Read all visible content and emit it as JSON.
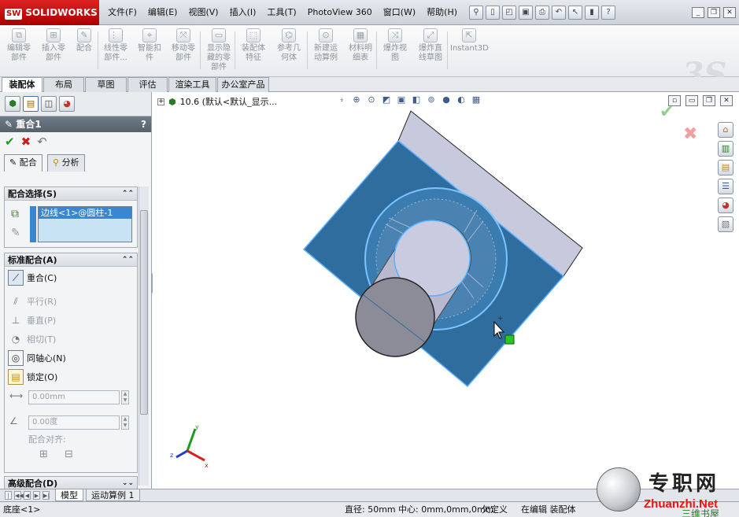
{
  "app": {
    "name": "SOLIDWORKS",
    "badge": "SW"
  },
  "menu": [
    "文件(F)",
    "编辑(E)",
    "视图(V)",
    "插入(I)",
    "工具(T)",
    "PhotoView 360",
    "窗口(W)",
    "帮助(H)"
  ],
  "quickbar_icons": [
    "pin-icon",
    "new-icon",
    "open-icon",
    "save-icon",
    "print-icon",
    "undo-icon",
    "select-icon",
    "rebuild-icon",
    "options-icon"
  ],
  "commands": [
    {
      "label": "编辑零\n部件",
      "icon": "edit-component-icon"
    },
    {
      "label": "插入零\n部件",
      "icon": "insert-component-icon"
    },
    {
      "label": "配合",
      "icon": "mate-icon"
    },
    {
      "label": "线性零\n部件...",
      "icon": "linear-pattern-icon"
    },
    {
      "label": "智能扣\n件",
      "icon": "smart-fastener-icon"
    },
    {
      "label": "移动零\n部件",
      "icon": "move-component-icon"
    },
    {
      "label": "显示隐\n藏的零\n部件",
      "icon": "show-hidden-icon"
    },
    {
      "label": "装配体\n特征",
      "icon": "assembly-feature-icon"
    },
    {
      "label": "参考几\n何体",
      "icon": "reference-geometry-icon"
    },
    {
      "label": "新建运\n动算例",
      "icon": "motion-study-icon"
    },
    {
      "label": "材料明\n细表",
      "icon": "bom-icon"
    },
    {
      "label": "爆炸视\n图",
      "icon": "exploded-view-icon"
    },
    {
      "label": "爆炸直\n线草图",
      "icon": "explode-line-icon"
    },
    {
      "label": "Instant3D",
      "icon": "instant3d-icon"
    }
  ],
  "tabs": [
    "装配体",
    "布局",
    "草图",
    "评估",
    "渲染工具",
    "办公室产品"
  ],
  "panel": {
    "title": "重合1",
    "help": "?",
    "subtabs": [
      "配合",
      "分析"
    ],
    "mate_selections": {
      "title": "配合选择(S)",
      "items": [
        "边线<1>@圆柱-1"
      ]
    },
    "standard_mates": {
      "title": "标准配合(A)",
      "options": [
        {
          "label": "重合(C)",
          "icon": "coincident-icon",
          "active": true,
          "enabled": true
        },
        {
          "label": "平行(R)",
          "icon": "parallel-icon",
          "active": false,
          "enabled": false
        },
        {
          "label": "垂直(P)",
          "icon": "perpendicular-icon",
          "active": false,
          "enabled": false
        },
        {
          "label": "相切(T)",
          "icon": "tangent-icon",
          "active": false,
          "enabled": false
        },
        {
          "label": "同轴心(N)",
          "icon": "concentric-icon",
          "active": false,
          "enabled": true
        },
        {
          "label": "锁定(O)",
          "icon": "lock-icon",
          "active": false,
          "enabled": true
        }
      ],
      "distance": "0.00mm",
      "angle": "0.00度",
      "alignment_label": "配合对齐:"
    },
    "advanced_title": "高级配合(D)"
  },
  "tree": {
    "root_label": "10.6  (默认<默认_显示..."
  },
  "bottom_tabs": [
    "模型",
    "运动算例 1"
  ],
  "status": {
    "left": "底座<1>",
    "diameter": "直径: 50mm",
    "center": "中心: 0mm,0mm,0mm",
    "underdefined": "欠定义",
    "editing": "在编辑 装配体"
  },
  "watermark": {
    "cn": "专职网",
    "en": "Zhuanzhi.Net",
    "sub": "三维书屋"
  },
  "colors": {
    "face_blue": "#2f6d9e",
    "face_edge": "#5ab0ff",
    "box_top": "#c7c9dc",
    "accept": "#1f9e1f",
    "cancel": "#d82020"
  },
  "triad": {
    "x": "x",
    "y": "y",
    "z": "z"
  }
}
